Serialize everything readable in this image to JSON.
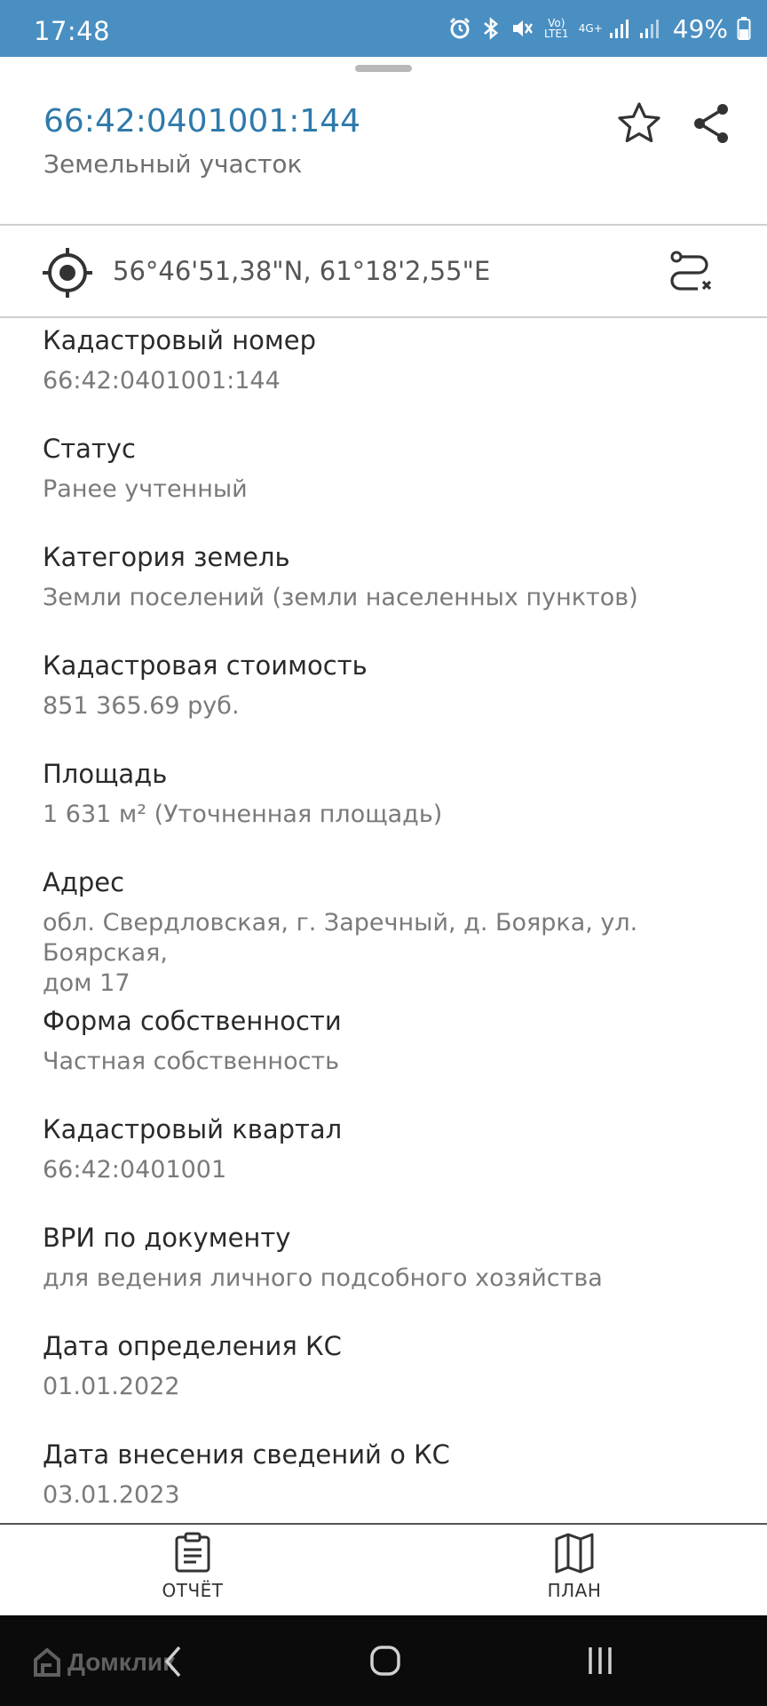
{
  "status_bar": {
    "time": "17:48",
    "battery": "49%",
    "network_volte": "Vo) LTE1",
    "network_type": "4G+",
    "icons": [
      "alarm-icon",
      "bluetooth-icon",
      "mute-icon",
      "volte-icon",
      "4g-icon",
      "signal-icon",
      "signal-icon",
      "battery-icon"
    ],
    "bg_color": "#4a8fc2"
  },
  "header": {
    "title": "66:42:0401001:144",
    "subtitle": "Земельный участок",
    "title_color": "#2f7aaa",
    "actions": [
      "star-icon",
      "share-icon"
    ]
  },
  "coordinates": {
    "text": "56°46'51,38\"N, 61°18'2,55\"E",
    "icons": [
      "target-icon",
      "route-icon"
    ]
  },
  "fields": [
    {
      "label": "Кадастровый номер",
      "value": "66:42:0401001:144"
    },
    {
      "label": "Статус",
      "value": "Ранее учтенный"
    },
    {
      "label": "Категория земель",
      "value": "Земли поселений (земли населенных пунктов)"
    },
    {
      "label": "Кадастровая стоимость",
      "value": "851 365.69 руб."
    },
    {
      "label": "Площадь",
      "value": "1 631 м² (Уточненная площадь)"
    },
    {
      "label": "Адрес",
      "value_line1": "обл. Свердловская, г. Заречный, д. Боярка, ул. Боярская,",
      "value_line2": "дом 17"
    },
    {
      "label": "Форма собственности",
      "value": "Частная собственность"
    },
    {
      "label": "Кадастровый квартал",
      "value": "66:42:0401001"
    },
    {
      "label": "ВРИ по документу",
      "value": "для ведения личного подсобного хозяйства"
    },
    {
      "label": "Дата определения КС",
      "value": "01.01.2022"
    },
    {
      "label": "Дата внесения сведений о КС",
      "value": "03.01.2023"
    }
  ],
  "bottom_nav": {
    "report_label": "ОТЧЁТ",
    "plan_label": "ПЛАН",
    "icons": [
      "clipboard-icon",
      "map-icon"
    ]
  },
  "system_nav": {
    "watermark": "Домклик",
    "icons": [
      "back-icon",
      "home-icon",
      "recents-icon"
    ]
  }
}
